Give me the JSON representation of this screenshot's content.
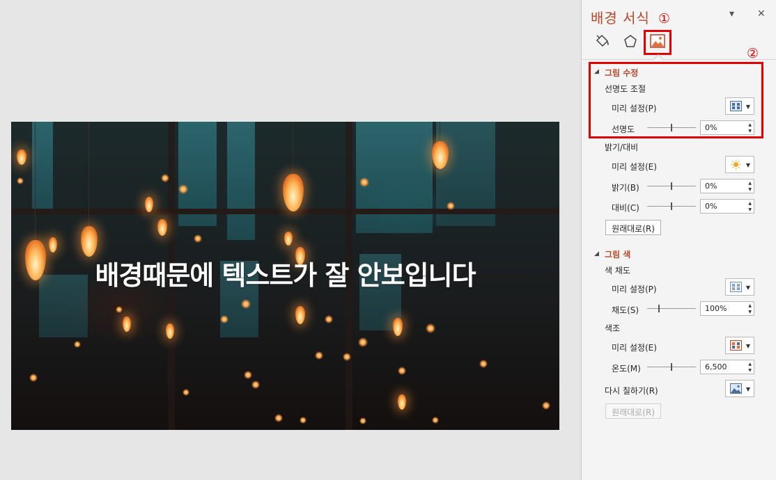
{
  "slide": {
    "text": "배경때문에 텍스트가 잘 안보입니다"
  },
  "pane": {
    "title": "배경 서식",
    "menu_glyph": "▾",
    "close_glyph": "✕",
    "tabs": [
      {
        "name": "fill-line",
        "icon": "paint-bucket-icon"
      },
      {
        "name": "effects",
        "icon": "pentagon-icon"
      },
      {
        "name": "picture",
        "icon": "picture-icon",
        "active": true
      }
    ],
    "annotations": {
      "one": "①",
      "two": "②"
    },
    "picture_corrections": {
      "header": "그림 수정",
      "sharpen": {
        "title": "선명도 조절",
        "preset_label": "미리 설정(P)",
        "sharpness_label": "선명도",
        "sharpness_value": "0%"
      },
      "brightness_contrast": {
        "title": "밝기/대비",
        "preset_label": "미리 설정(E)",
        "brightness_label": "밝기(B)",
        "brightness_value": "0%",
        "contrast_label": "대비(C)",
        "contrast_value": "0%",
        "reset_label": "원래대로(R)"
      }
    },
    "picture_color": {
      "header": "그림 색",
      "saturation": {
        "title": "색 채도",
        "preset_label": "미리 설정(P)",
        "saturation_label": "채도(S)",
        "saturation_value": "100%"
      },
      "tone": {
        "title": "색조",
        "preset_label": "미리 설정(E)",
        "temperature_label": "온도(M)",
        "temperature_value": "6,500"
      },
      "recolor_label": "다시 칠하기(R)",
      "reset_label": "원래대로(R)"
    },
    "colors": {
      "accent": "#b7472a",
      "annotation_red": "#e00000"
    }
  }
}
